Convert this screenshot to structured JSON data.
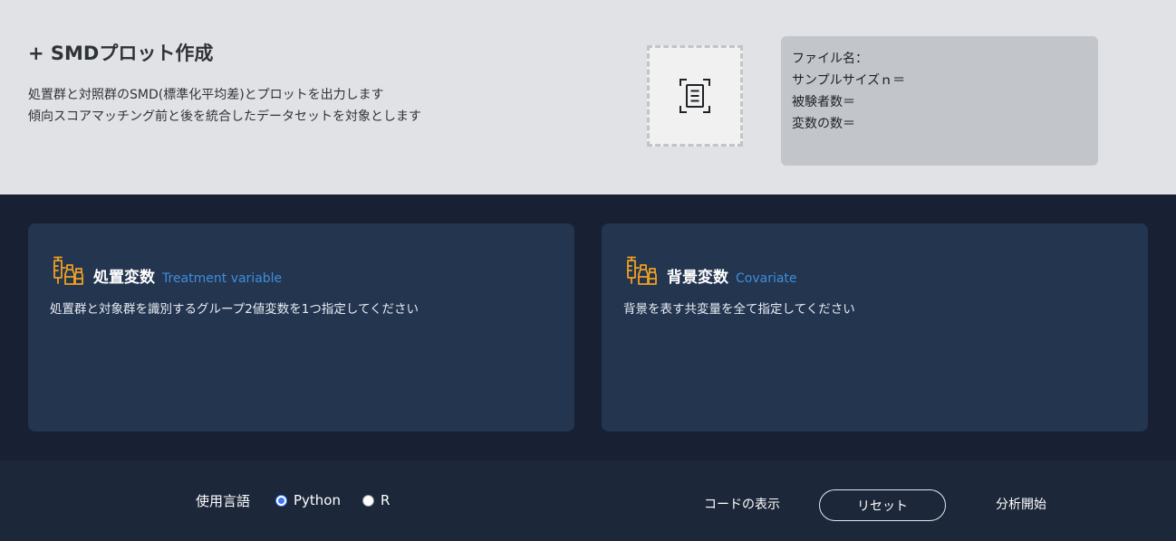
{
  "header": {
    "title": "+ SMDプロット作成",
    "description_lines": [
      "処置群と対照群のSMD(標準化平均差)とプロットを出力します",
      "傾向スコアマッチング前と後を統合したデータセットを対象とします"
    ],
    "dropzone_icon": "document-scan-icon",
    "file_info": {
      "file_name": "ファイル名：",
      "sample_size": "サンプルサイズｎ＝",
      "subjects": "被験者数＝",
      "variables": "変数の数＝"
    }
  },
  "cards": {
    "treatment": {
      "icon": "syringe-vial-icon",
      "title": "処置変数",
      "subtitle": "Treatment variable",
      "description": "処置群と対象群を識別するグループ2値変数を1つ指定してください"
    },
    "covariate": {
      "icon": "syringe-vial-icon",
      "title": "背景変数",
      "subtitle": "Covariate",
      "description": "背景を表す共変量を全て指定してください"
    }
  },
  "footer": {
    "language_label": "使用言語",
    "language_options": [
      {
        "label": "Python",
        "selected": true
      },
      {
        "label": "R",
        "selected": false
      }
    ],
    "show_code_label": "コードの表示",
    "reset_label": "リセット",
    "run_label": "分析開始"
  },
  "colors": {
    "accent_orange": "#f0a020",
    "subtitle_blue": "#3f8edb",
    "radio_blue": "#3a78f2",
    "card_bg": "#243550",
    "page_bg": "#172133"
  }
}
